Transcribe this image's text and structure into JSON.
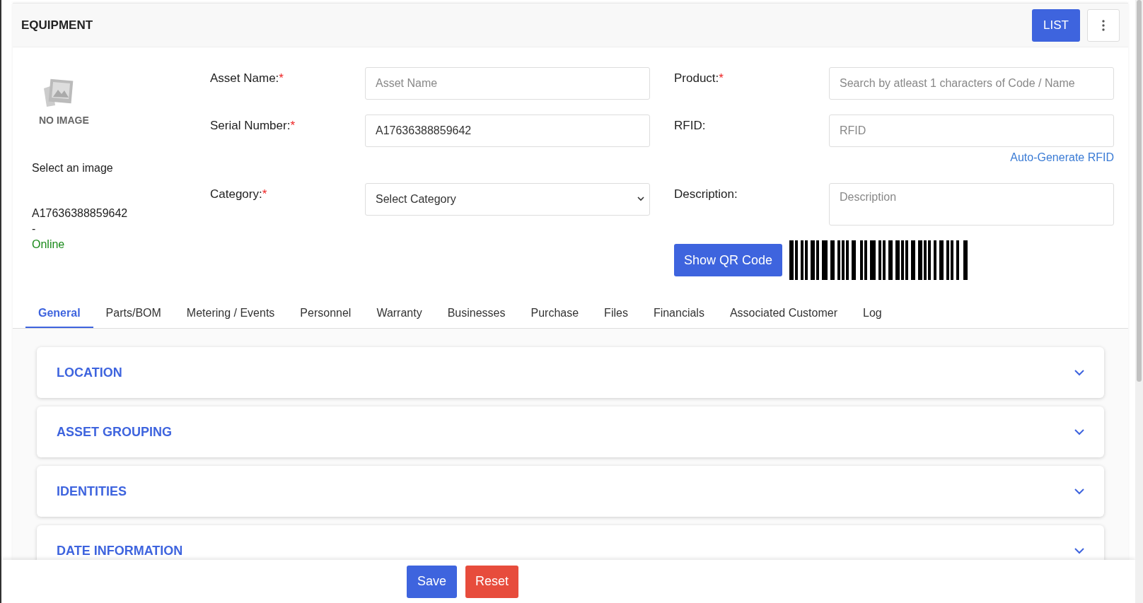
{
  "header": {
    "title": "EQUIPMENT",
    "list_button": "LIST"
  },
  "image": {
    "caption": "NO IMAGE",
    "select_label": "Select an image"
  },
  "summary": {
    "serial": "A17636388859642",
    "separator": "-",
    "status": "Online"
  },
  "fields_left": [
    {
      "label": "Asset Name:",
      "required_mark": "*",
      "kind": "input",
      "placeholder": "Asset Name"
    },
    {
      "label": "Serial Number:",
      "required_mark": "*",
      "kind": "input",
      "value": "A17636388859642"
    },
    {
      "label": "Category:",
      "required_mark": "*",
      "kind": "select",
      "value": "Select Category"
    }
  ],
  "fields_right": [
    {
      "label": "Product:",
      "required_mark": "*",
      "kind": "input",
      "placeholder": "Search by atleast 1 characters of Code / Name"
    },
    {
      "label": "RFID:",
      "kind": "input",
      "placeholder": "RFID",
      "link": "Auto-Generate RFID"
    },
    {
      "label": "Description:",
      "kind": "textarea",
      "placeholder": "Description"
    }
  ],
  "qr_button": "Show QR Code",
  "tabs": [
    {
      "label": "General",
      "selected": true
    },
    {
      "label": "Parts/BOM",
      "selected": false
    },
    {
      "label": "Metering / Events",
      "selected": false
    },
    {
      "label": "Personnel",
      "selected": false
    },
    {
      "label": "Warranty",
      "selected": false
    },
    {
      "label": "Businesses",
      "selected": false
    },
    {
      "label": "Purchase",
      "selected": false
    },
    {
      "label": "Files",
      "selected": false
    },
    {
      "label": "Financials",
      "selected": false
    },
    {
      "label": "Associated Customer",
      "selected": false
    },
    {
      "label": "Log",
      "selected": false
    }
  ],
  "sections": [
    {
      "title": "LOCATION",
      "expanded": false
    },
    {
      "title": "ASSET GROUPING",
      "expanded": false
    },
    {
      "title": "IDENTITIES",
      "expanded": false
    },
    {
      "title": "DATE INFORMATION",
      "expanded": false
    }
  ],
  "footer": {
    "save": "Save",
    "reset": "Reset"
  }
}
